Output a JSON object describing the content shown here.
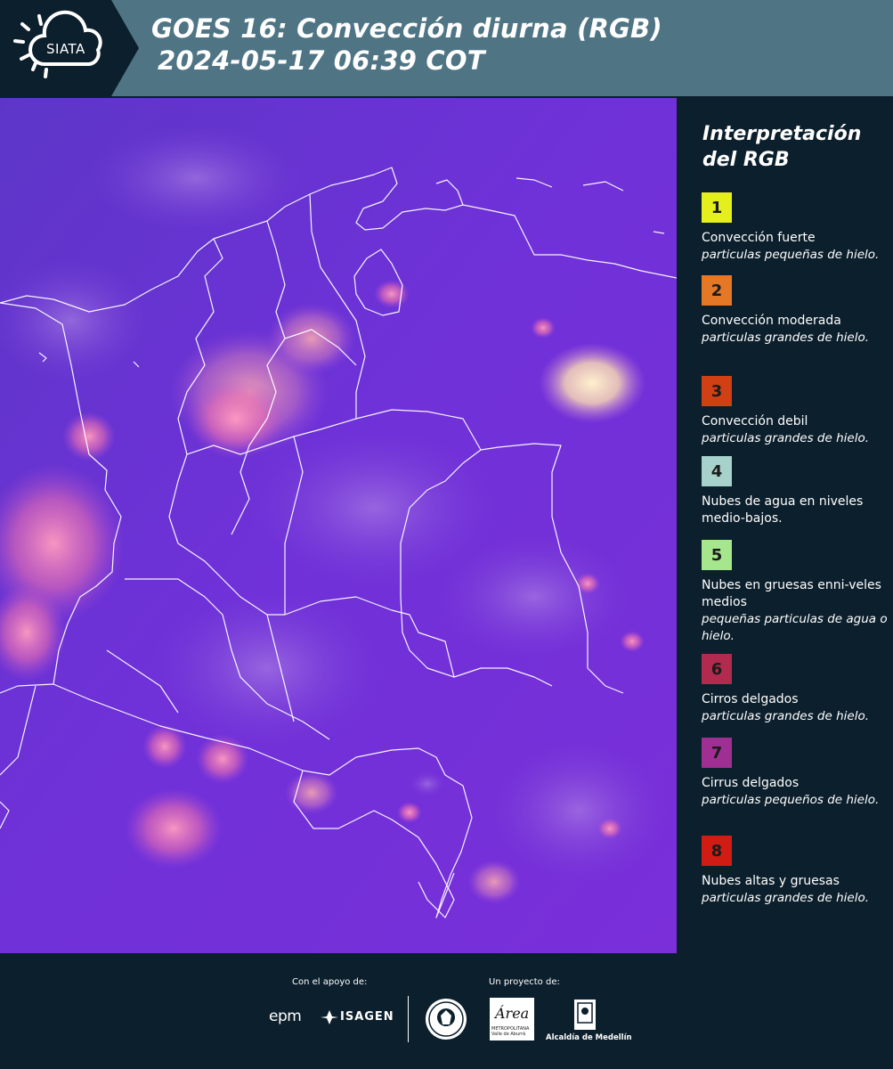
{
  "header": {
    "logo_text": "SIATA",
    "title_line1": "GOES 16: Convección diurna (RGB)",
    "title_line2": "2024-05-17 06:39 COT"
  },
  "legend": {
    "title_line1": "Interpretación",
    "title_line2": "del RGB",
    "items": [
      {
        "number": "1",
        "color": "#e6ef1e",
        "name": "Convección fuerte",
        "desc": "particulas pequeñas de hielo."
      },
      {
        "number": "2",
        "color": "#e47826",
        "name": "Convección moderada",
        "desc": "particulas grandes de hielo."
      },
      {
        "number": "3",
        "color": "#d13f14",
        "name": "Convección debil",
        "desc": "particulas grandes de hielo."
      },
      {
        "number": "4",
        "color": "#a7d1cb",
        "name": "Nubes de agua en niveles medio-bajos.",
        "desc": ""
      },
      {
        "number": "5",
        "color": "#a6e68c",
        "name": "Nubes en gruesas enni-veles medios",
        "desc": "pequeñas particulas de agua o hielo."
      },
      {
        "number": "6",
        "color": "#b22a4d",
        "name": "Cirros delgados",
        "desc": "particulas grandes de hielo."
      },
      {
        "number": "7",
        "color": "#9f2f93",
        "name": "Cirrus delgados",
        "desc": "particulas pequeños de hielo."
      },
      {
        "number": "8",
        "color": "#d01c13",
        "name": "Nubes altas y gruesas",
        "desc": "particulas grandes de hielo."
      }
    ]
  },
  "footer": {
    "support_label": "Con el apoyo de:",
    "project_label": "Un proyecto de:",
    "epm": "epm",
    "isagen": "ISAGEN",
    "area_logo": "Área",
    "area_subtext": "METROPOLITANA Valle de Aburrá",
    "medellin": "Alcaldía de Medellín"
  },
  "colors": {
    "header_bg": "#4f7585",
    "panel_bg": "#0c1f2c",
    "map_base": "#6a2fd6"
  }
}
